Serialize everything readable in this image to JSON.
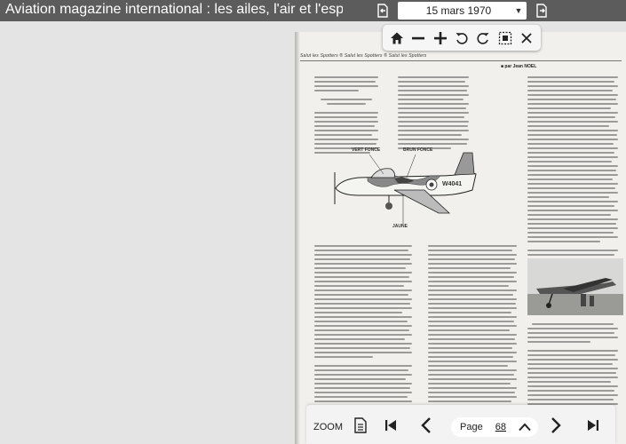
{
  "header": {
    "title": "Aviation magazine international : les ailes, l'air et l'espa…",
    "date": "15 mars 1970",
    "colors": {
      "bar": "#5c5c5c",
      "text": "#ffffff"
    },
    "icons": [
      "page-back-icon",
      "page-forward-icon",
      "chevron-down-icon"
    ]
  },
  "page": {
    "section_header": "Salut les Spotters ® Salut les Spotters ® Salut les Spotters",
    "author": "■ par Jean NOEL",
    "drawing_labels": {
      "top_left": "VERT FONCE",
      "top_right": "BRUN FONCE",
      "serial": "W4041",
      "bottom": "JAUNE"
    }
  },
  "toolbar": {
    "icons": [
      "home-icon",
      "zoom-out-icon",
      "zoom-in-icon",
      "rotate-left-icon",
      "rotate-right-icon",
      "fit-selection-icon",
      "close-icon"
    ]
  },
  "bottom": {
    "zoom_label": "ZOOM",
    "page_label": "Page",
    "page_number": "68",
    "icons": [
      "document-icon",
      "first-page-icon",
      "previous-page-icon",
      "page-up-icon",
      "next-page-icon",
      "last-page-icon"
    ]
  }
}
